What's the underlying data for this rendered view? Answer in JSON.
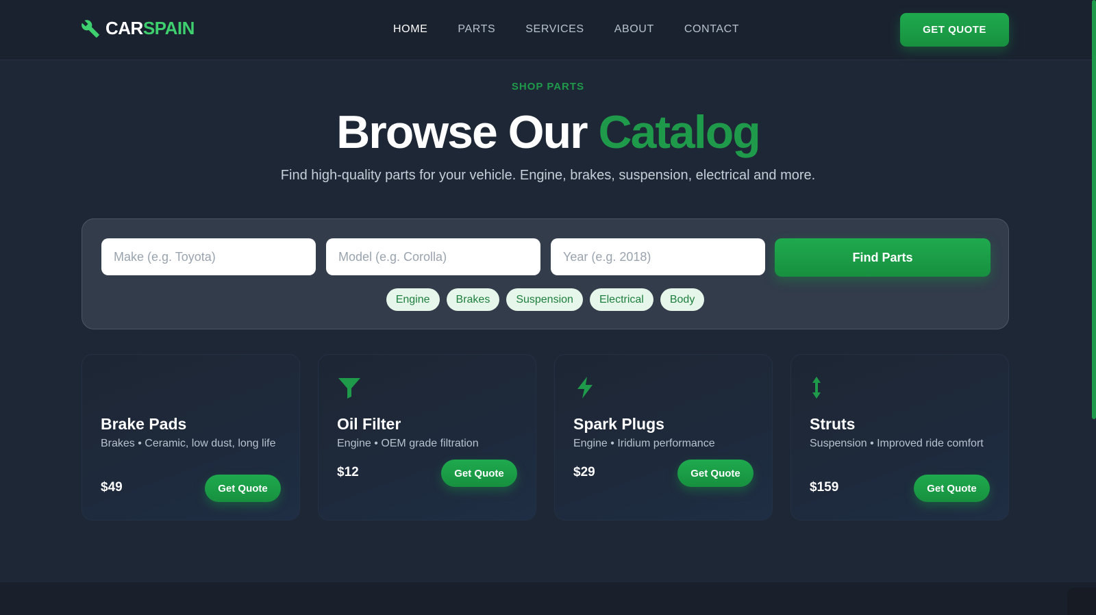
{
  "brand": {
    "car": "CAR",
    "spain": "SPAIN",
    "icon": "wrench-icon"
  },
  "nav": {
    "items": [
      {
        "label": "HOME",
        "active": true
      },
      {
        "label": "PARTS"
      },
      {
        "label": "SERVICES"
      },
      {
        "label": "ABOUT"
      },
      {
        "label": "CONTACT"
      }
    ],
    "cta": "GET QUOTE"
  },
  "hero": {
    "eyebrow": "SHOP PARTS",
    "title_white": "Browse Our",
    "title_green": "Catalog",
    "subtitle": "Find high-quality parts for your vehicle. Engine, brakes, suspension, electrical and more."
  },
  "search": {
    "make_placeholder": "Make (e.g. Toyota)",
    "model_placeholder": "Model (e.g. Corolla)",
    "year_placeholder": "Year (e.g. 2018)",
    "button": "Find Parts",
    "chips": [
      "Engine",
      "Brakes",
      "Suspension",
      "Electrical",
      "Body"
    ]
  },
  "products": [
    {
      "title": "Brake Pads",
      "desc": "Brakes • Ceramic, low dust, long life",
      "price": "$49",
      "button": "Get Quote",
      "icon": "brake-icon"
    },
    {
      "title": "Oil Filter",
      "desc": "Engine • OEM grade filtration",
      "price": "$12",
      "button": "Get Quote",
      "icon": "filter-icon"
    },
    {
      "title": "Spark Plugs",
      "desc": "Engine • Iridium performance",
      "price": "$29",
      "button": "Get Quote",
      "icon": "lightning-icon"
    },
    {
      "title": "Struts",
      "desc": "Suspension • Improved ride comfort",
      "price": "$159",
      "button": "Get Quote",
      "icon": "vertical-arrows-icon"
    }
  ],
  "colors": {
    "accent": "#1f9a4b",
    "background": "#1e2735",
    "chip_bg": "#e6f6ea"
  }
}
